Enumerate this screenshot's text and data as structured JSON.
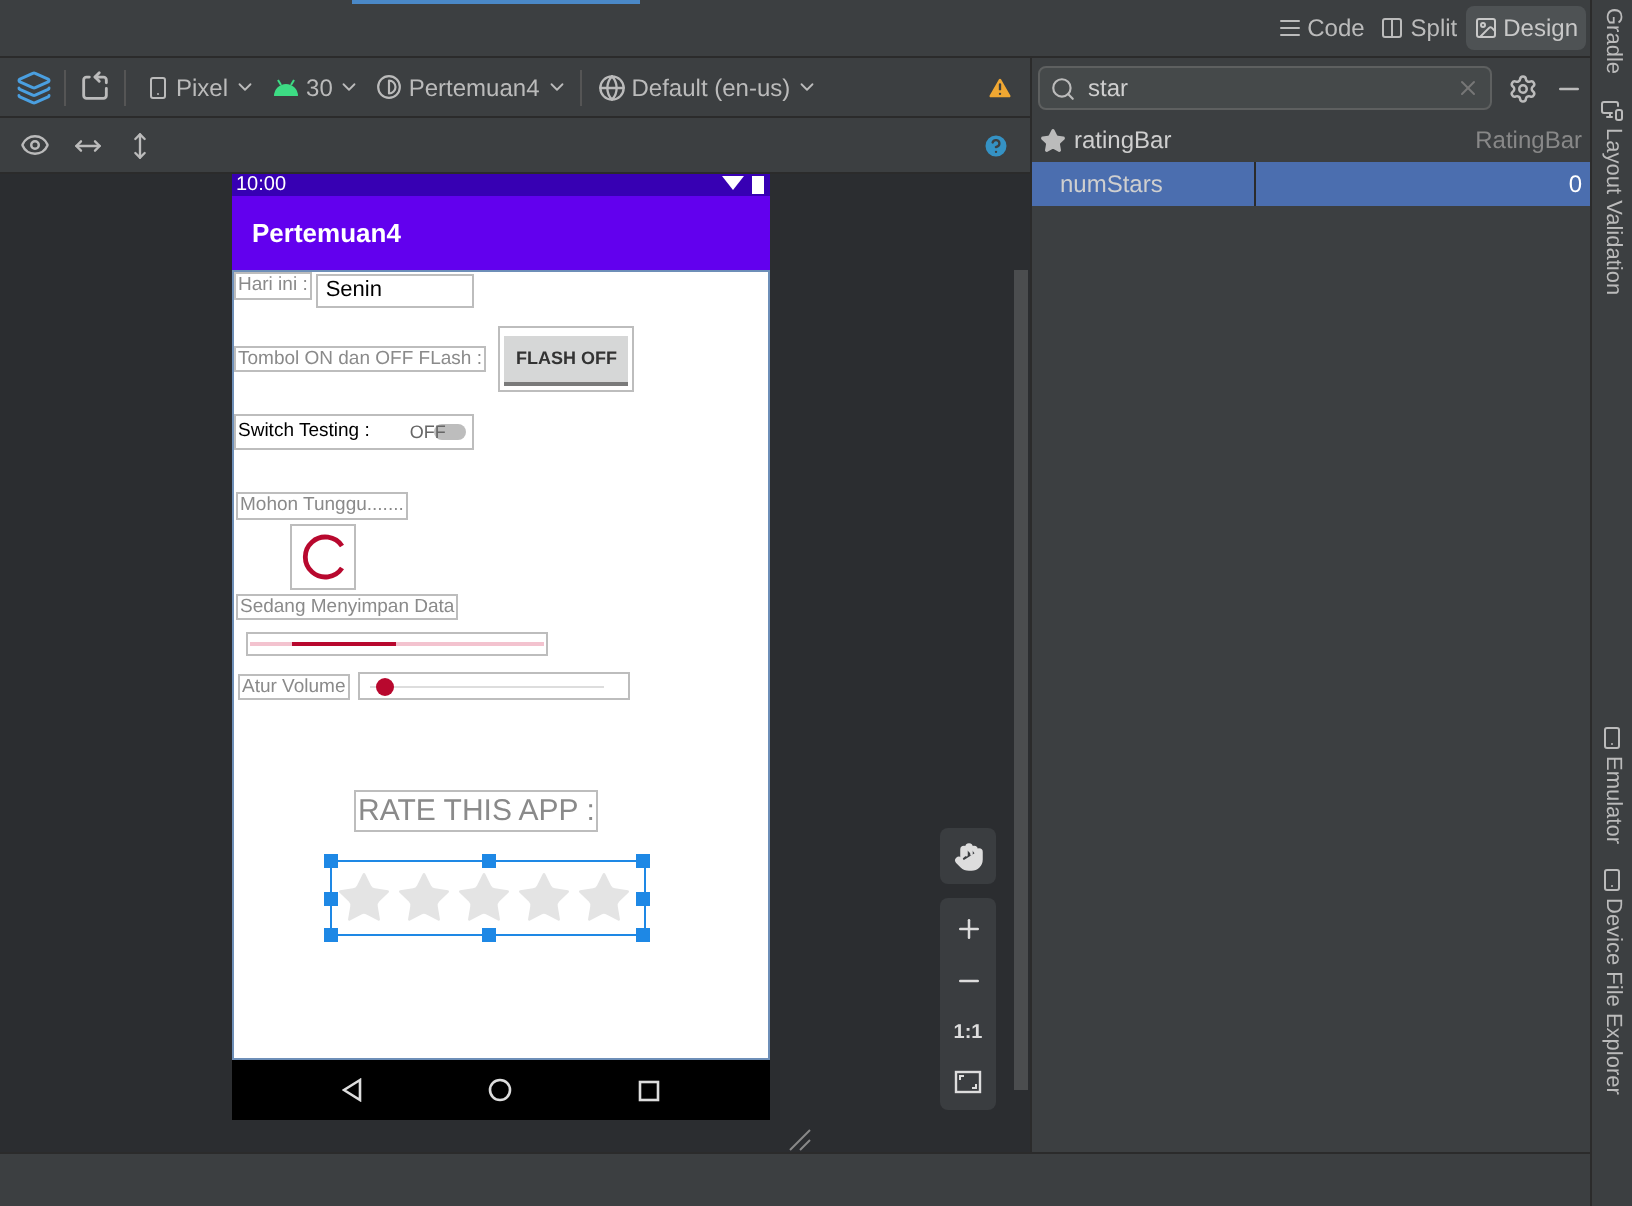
{
  "view_modes": [
    {
      "label": "Code",
      "selected": false
    },
    {
      "label": "Split",
      "selected": false
    },
    {
      "label": "Design",
      "selected": true
    }
  ],
  "toolbar": {
    "device": "Pixel",
    "api": "30",
    "theme": "Pertemuan4",
    "locale": "Default (en-us)"
  },
  "attributes": {
    "search": {
      "value": "star"
    },
    "rows": [
      {
        "kind": "header",
        "name": "ratingBar",
        "value": "RatingBar",
        "selected": false
      },
      {
        "kind": "field",
        "name": "numStars",
        "value": "0",
        "selected": true
      }
    ]
  },
  "side_tools": [
    "Gradle",
    "Layout Validation",
    "Emulator",
    "Device File Explorer"
  ],
  "phone": {
    "time": "10:00",
    "app_title": "Pertemuan4",
    "day_label": "Hari ini :",
    "day_value": "Senin",
    "flash_label": "Tombol ON dan OFF FLash :",
    "flash_button": "FLASH OFF",
    "switch": {
      "label": "Switch Testing :",
      "text": "OFF",
      "on": false
    },
    "wait_label": "Mohon Tunggu.......",
    "save_label": "Sedang Menyimpan Data",
    "progress": {
      "level": 0.36
    },
    "volume": {
      "label": "Atur Volume",
      "level": 0.03
    },
    "rate_label": "RATE THIS APP :",
    "rating": {
      "stars": 0
    }
  },
  "zoom_controls": {
    "actual_size": "1:1"
  }
}
